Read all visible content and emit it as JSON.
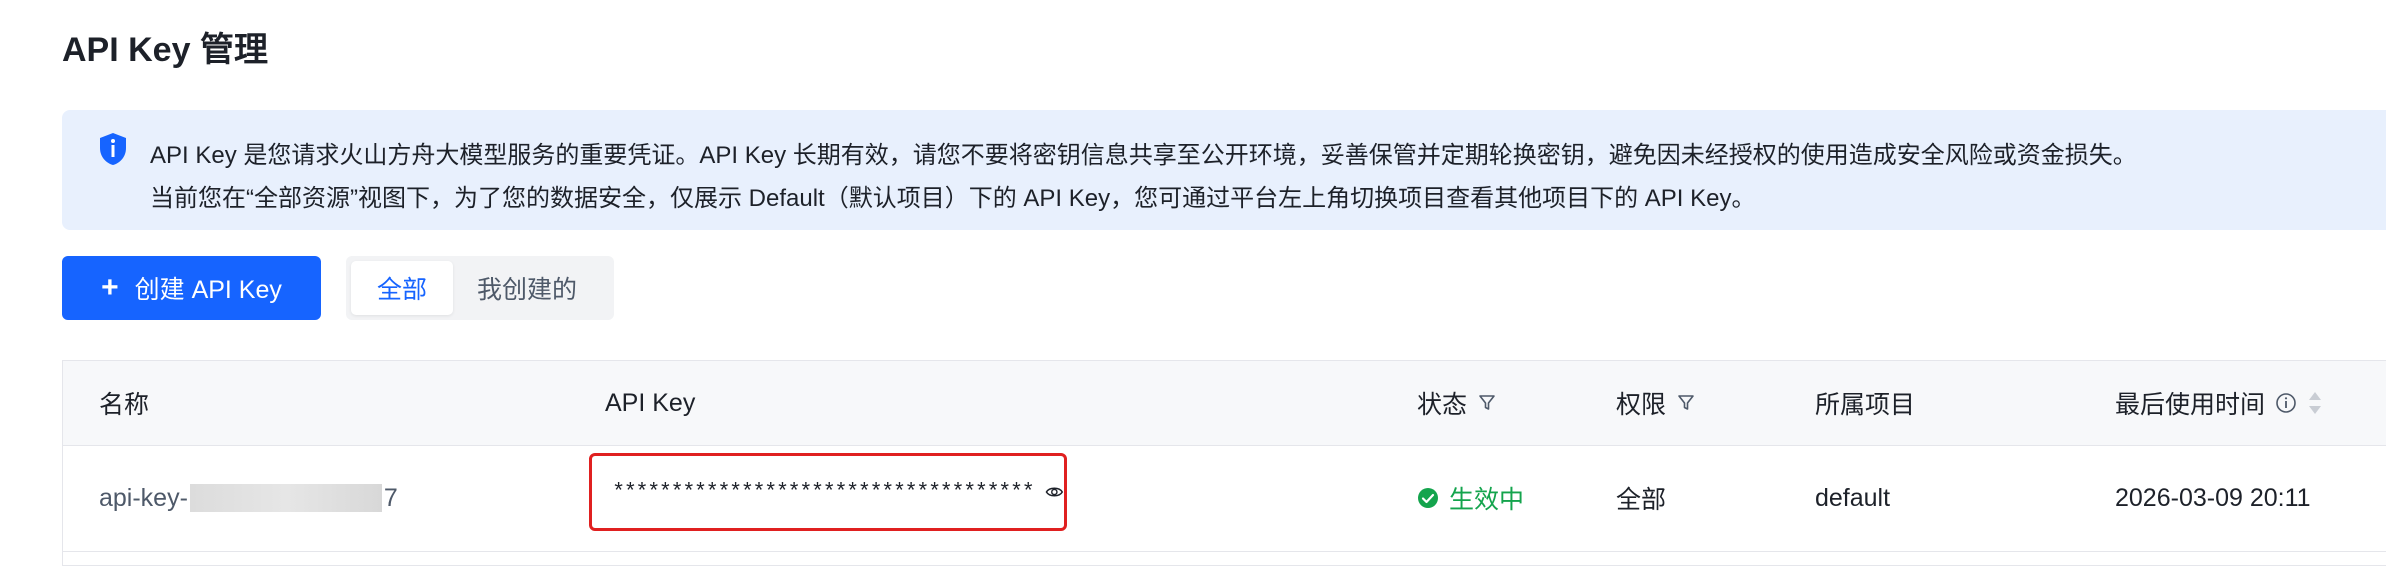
{
  "page": {
    "title": "API Key 管理"
  },
  "notice": {
    "line1": "API Key 是您请求火山方舟大模型服务的重要凭证。API Key 长期有效，请您不要将密钥信息共享至公开环境，妥善保管并定期轮换密钥，避免因未经授权的使用造成安全风险或资金损失。",
    "line2": "当前您在“全部资源”视图下，为了您的数据安全，仅展示 Default（默认项目）下的 API Key，您可通过平台左上角切换项目查看其他项目下的 API Key。"
  },
  "toolbar": {
    "create_label": "创建 API Key",
    "tabs": [
      {
        "label": "全部",
        "active": true
      },
      {
        "label": "我创建的",
        "active": false
      }
    ]
  },
  "table": {
    "columns": [
      "名称",
      "API Key",
      "状态",
      "权限",
      "所属项目",
      "最后使用时间"
    ],
    "rows": [
      {
        "name_prefix": "api-key-",
        "name_suffix": "7",
        "api_key": "************************************",
        "status": "生效中",
        "permission": "全部",
        "project": "default",
        "last_used": "2026-03-09 20:11"
      }
    ]
  },
  "colors": {
    "accent": "#1664ff",
    "status_active": "#14a44d",
    "highlight_border": "#e02020",
    "notice_bg": "#e8f0fd"
  },
  "icons": [
    "info-shield-icon",
    "plus-icon",
    "filter-icon",
    "eye-icon",
    "check-circle-icon",
    "info-circle-icon",
    "sort-icon"
  ]
}
